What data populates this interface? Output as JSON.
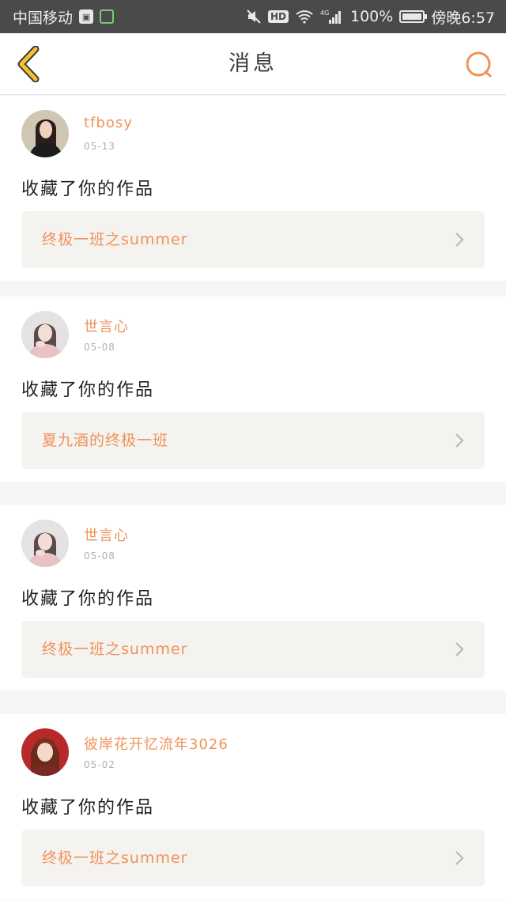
{
  "status_bar": {
    "carrier": "中国移动",
    "network": "4G",
    "battery": "100%",
    "time": "傍晚6:57"
  },
  "header": {
    "title": "消息"
  },
  "colors": {
    "accent": "#f0925a",
    "back_arrow": "#f2c12e",
    "card_inner": "#f4f3ef",
    "status_bar": "#4a4a4a"
  },
  "messages": [
    {
      "user": "tfbosy",
      "date": "05-13",
      "action": "收藏了你的作品",
      "work_title": "终极一班之summer",
      "avatar_icon": "avatar-photo"
    },
    {
      "user": "世言心",
      "date": "05-08",
      "action": "收藏了你的作品",
      "work_title": "夏九酒的终极一班",
      "avatar_icon": "avatar-photo"
    },
    {
      "user": "世言心",
      "date": "05-08",
      "action": "收藏了你的作品",
      "work_title": "终极一班之summer",
      "avatar_icon": "avatar-photo"
    },
    {
      "user": "彼岸花开忆流年3026",
      "date": "05-02",
      "action": "收藏了你的作品",
      "work_title": "终极一班之summer",
      "avatar_icon": "avatar-photo"
    }
  ]
}
